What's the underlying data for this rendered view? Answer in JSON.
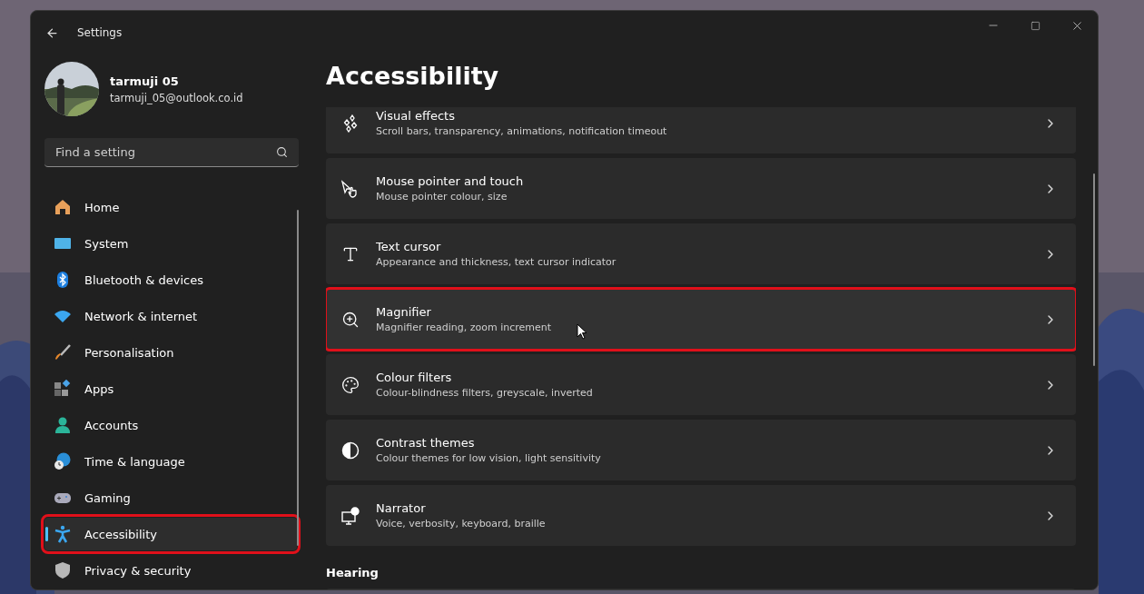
{
  "window": {
    "title": "Settings"
  },
  "profile": {
    "name": "tarmuji 05",
    "email": "tarmuji_05@outlook.co.id"
  },
  "search": {
    "placeholder": "Find a setting"
  },
  "sidebar": {
    "items": [
      {
        "label": "Home",
        "kind": "home",
        "selected": false,
        "highlighted": false
      },
      {
        "label": "System",
        "kind": "system",
        "selected": false,
        "highlighted": false
      },
      {
        "label": "Bluetooth & devices",
        "kind": "bluetooth",
        "selected": false,
        "highlighted": false
      },
      {
        "label": "Network & internet",
        "kind": "network",
        "selected": false,
        "highlighted": false
      },
      {
        "label": "Personalisation",
        "kind": "brush",
        "selected": false,
        "highlighted": false
      },
      {
        "label": "Apps",
        "kind": "apps",
        "selected": false,
        "highlighted": false
      },
      {
        "label": "Accounts",
        "kind": "accounts",
        "selected": false,
        "highlighted": false
      },
      {
        "label": "Time & language",
        "kind": "time",
        "selected": false,
        "highlighted": false
      },
      {
        "label": "Gaming",
        "kind": "gaming",
        "selected": false,
        "highlighted": false
      },
      {
        "label": "Accessibility",
        "kind": "accessibility",
        "selected": true,
        "highlighted": true
      },
      {
        "label": "Privacy & security",
        "kind": "privacy",
        "selected": false,
        "highlighted": false
      }
    ]
  },
  "page": {
    "title": "Accessibility",
    "cards": [
      {
        "title": "Visual effects",
        "subtitle": "Scroll bars, transparency, animations, notification timeout",
        "kind": "sparkle",
        "highlighted": false
      },
      {
        "title": "Mouse pointer and touch",
        "subtitle": "Mouse pointer colour, size",
        "kind": "pointer",
        "highlighted": false
      },
      {
        "title": "Text cursor",
        "subtitle": "Appearance and thickness, text cursor indicator",
        "kind": "cursor",
        "highlighted": false
      },
      {
        "title": "Magnifier",
        "subtitle": "Magnifier reading, zoom increment",
        "kind": "magnifier",
        "highlighted": true
      },
      {
        "title": "Colour filters",
        "subtitle": "Colour-blindness filters, greyscale, inverted",
        "kind": "palette",
        "highlighted": false
      },
      {
        "title": "Contrast themes",
        "subtitle": "Colour themes for low vision, light sensitivity",
        "kind": "contrast",
        "highlighted": false
      },
      {
        "title": "Narrator",
        "subtitle": "Voice, verbosity, keyboard, braille",
        "kind": "narrator",
        "highlighted": false
      }
    ],
    "section": "Hearing"
  }
}
